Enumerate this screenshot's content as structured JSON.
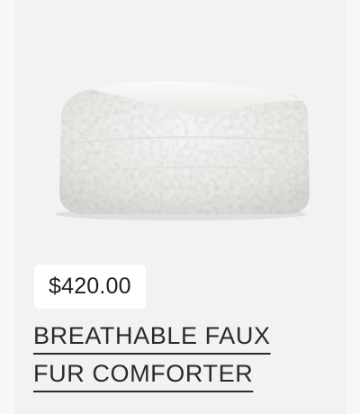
{
  "product": {
    "image_name": "faux-fur-comforter-folded",
    "price": "$420.00",
    "title": "BREATHABLE FAUX FUR COMFORTER"
  },
  "colors": {
    "card_background": "#f2f2f2",
    "badge_background": "#ffffff",
    "text": "#2a2a2a"
  }
}
